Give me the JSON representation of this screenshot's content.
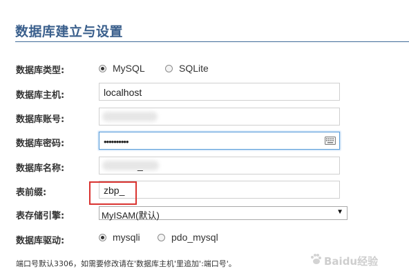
{
  "page": {
    "title": "数据库建立与设置"
  },
  "db_type": {
    "label": "数据库类型:",
    "options": [
      {
        "label": "MySQL",
        "selected": true
      },
      {
        "label": "SQLite",
        "selected": false
      }
    ]
  },
  "db_host": {
    "label": "数据库主机:",
    "value": "localhost"
  },
  "db_user": {
    "label": "数据库账号:",
    "value": ""
  },
  "db_password": {
    "label": "数据库密码:",
    "value": "••••••••••"
  },
  "db_name": {
    "label": "数据库名称:",
    "value": "_"
  },
  "table_prefix": {
    "label": "表前缀:",
    "value": "zbp_"
  },
  "storage_engine": {
    "label": "表存储引擎:",
    "value": "MyISAM(默认)"
  },
  "db_driver": {
    "label": "数据库驱动:",
    "options": [
      {
        "label": "mysqli",
        "selected": true
      },
      {
        "label": "pdo_mysql",
        "selected": false
      }
    ]
  },
  "note": "端口号默认3306，如需要修改请在'数据库主机'里追加':端口号'。",
  "watermark": {
    "text": "Baidu经验"
  },
  "colors": {
    "title": "#3a5f8c",
    "highlight_box": "#d9322f",
    "focus_border": "#5b9dd9"
  }
}
